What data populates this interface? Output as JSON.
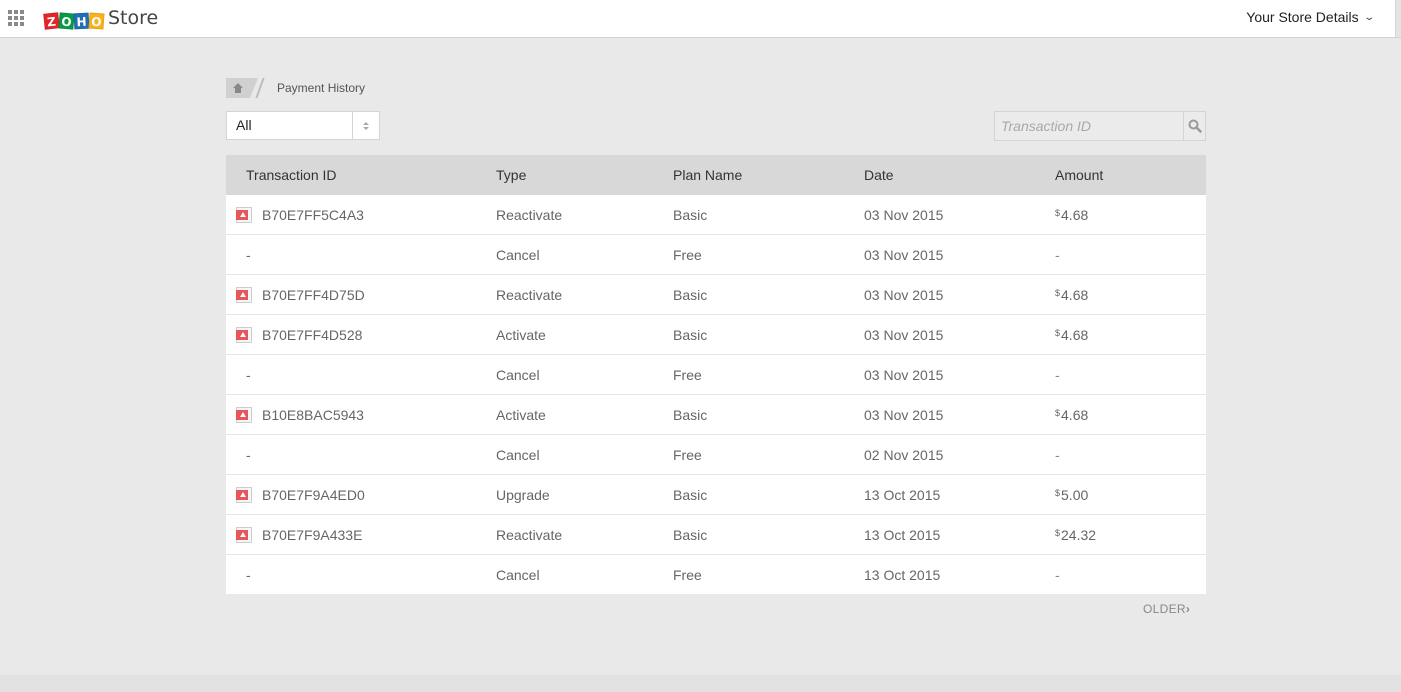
{
  "header": {
    "app_name": "Store",
    "logo_letters": [
      "Z",
      "O",
      "H",
      "O"
    ],
    "store_details_label": "Your Store Details"
  },
  "breadcrumb": {
    "current": "Payment History"
  },
  "filter": {
    "selected": "All"
  },
  "search": {
    "placeholder": "Transaction ID",
    "value": ""
  },
  "table": {
    "columns": [
      "Transaction ID",
      "Type",
      "Plan Name",
      "Date",
      "Amount"
    ],
    "rows": [
      {
        "id": "B70E7FF5C4A3",
        "has_invoice": true,
        "type": "Reactivate",
        "plan": "Basic",
        "date": "03 Nov 2015",
        "currency": "$",
        "amount": "4.68"
      },
      {
        "id": "-",
        "has_invoice": false,
        "type": "Cancel",
        "plan": "Free",
        "date": "03 Nov 2015",
        "currency": "",
        "amount": "-"
      },
      {
        "id": "B70E7FF4D75D",
        "has_invoice": true,
        "type": "Reactivate",
        "plan": "Basic",
        "date": "03 Nov 2015",
        "currency": "$",
        "amount": "4.68"
      },
      {
        "id": "B70E7FF4D528",
        "has_invoice": true,
        "type": "Activate",
        "plan": "Basic",
        "date": "03 Nov 2015",
        "currency": "$",
        "amount": "4.68"
      },
      {
        "id": "-",
        "has_invoice": false,
        "type": "Cancel",
        "plan": "Free",
        "date": "03 Nov 2015",
        "currency": "",
        "amount": "-"
      },
      {
        "id": "B10E8BAC5943",
        "has_invoice": true,
        "type": "Activate",
        "plan": "Basic",
        "date": "03 Nov 2015",
        "currency": "$",
        "amount": "4.68"
      },
      {
        "id": "-",
        "has_invoice": false,
        "type": "Cancel",
        "plan": "Free",
        "date": "02 Nov 2015",
        "currency": "",
        "amount": "-"
      },
      {
        "id": "B70E7F9A4ED0",
        "has_invoice": true,
        "type": "Upgrade",
        "plan": "Basic",
        "date": "13 Oct 2015",
        "currency": "$",
        "amount": "5.00"
      },
      {
        "id": "B70E7F9A433E",
        "has_invoice": true,
        "type": "Reactivate",
        "plan": "Basic",
        "date": "13 Oct 2015",
        "currency": "$",
        "amount": "24.32"
      },
      {
        "id": "-",
        "has_invoice": false,
        "type": "Cancel",
        "plan": "Free",
        "date": "13 Oct 2015",
        "currency": "",
        "amount": "-"
      }
    ]
  },
  "pagination": {
    "older_label": "OLDER",
    "older_arrow": "›"
  },
  "icons": {
    "apps": "apps-grid-icon",
    "home": "home-icon",
    "search": "search-icon",
    "invoice": "pdf-icon",
    "dropdown": "chevron-down-icon"
  }
}
